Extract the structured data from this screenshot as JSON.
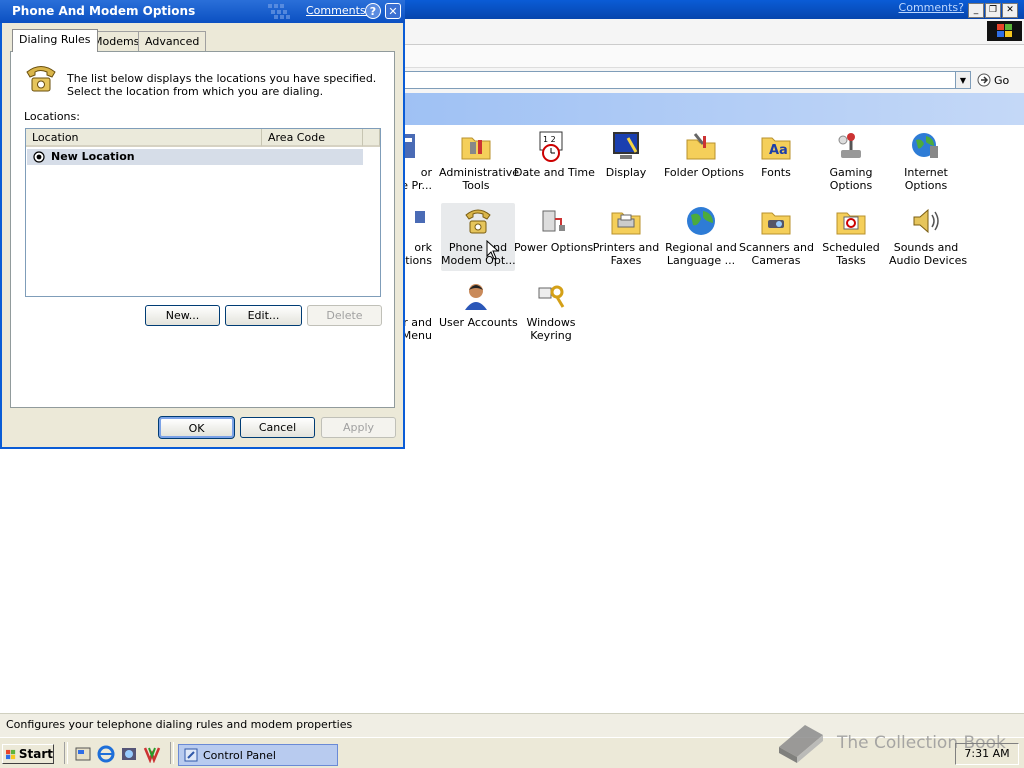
{
  "control_panel": {
    "comments_link": "Comments?",
    "go_label": "Go",
    "status_text": "Configures your telephone dialing rules and modem properties",
    "items": [
      {
        "label": "or\ne Pr...",
        "icon": "speech-icon"
      },
      {
        "label": "Administrative\nTools",
        "icon": "admin-tools-icon"
      },
      {
        "label": "Date and Time",
        "icon": "calendar-clock-icon"
      },
      {
        "label": "Display",
        "icon": "display-icon"
      },
      {
        "label": "Folder Options",
        "icon": "folder-options-icon"
      },
      {
        "label": "Fonts",
        "icon": "fonts-folder-icon"
      },
      {
        "label": "Gaming\nOptions",
        "icon": "joystick-icon"
      },
      {
        "label": "Internet\nOptions",
        "icon": "globe-icon"
      },
      {
        "label": "ork\nctions",
        "icon": "network-icon"
      },
      {
        "label": "Phone and\nModem Opt...",
        "icon": "telephone-icon"
      },
      {
        "label": "Power Options",
        "icon": "power-icon"
      },
      {
        "label": "Printers and\nFaxes",
        "icon": "printer-icon"
      },
      {
        "label": "Regional and\nLanguage ...",
        "icon": "world-icon"
      },
      {
        "label": "Scanners and\nCameras",
        "icon": "scanner-icon"
      },
      {
        "label": "Scheduled\nTasks",
        "icon": "scheduled-tasks-icon"
      },
      {
        "label": "Sounds and\nAudio Devices",
        "icon": "speaker-icon"
      },
      {
        "label": "r and\nMenu",
        "icon": "taskbar-icon"
      },
      {
        "label": "User Accounts",
        "icon": "user-icon"
      },
      {
        "label": "Windows\nKeyring",
        "icon": "keyring-icon"
      }
    ]
  },
  "taskbar": {
    "start_label": "Start",
    "task_label": "Control Panel",
    "clock": "7:31 AM",
    "watermark": "The Collection Book"
  },
  "dialog": {
    "title": "Phone And Modem Options",
    "comments_link": "Comments?",
    "help_label": "?",
    "close_label": "✕",
    "tabs": [
      "Dialing Rules",
      "Modems",
      "Advanced"
    ],
    "description": "The list below displays the locations you have specified. Select the location from which you are dialing.",
    "locations_label": "Locations:",
    "columns": [
      "Location",
      "Area Code"
    ],
    "rows": [
      {
        "location": "New Location",
        "area_code": ""
      }
    ],
    "buttons": {
      "new": "New...",
      "edit": "Edit...",
      "delete": "Delete",
      "ok": "OK",
      "cancel": "Cancel",
      "apply": "Apply"
    }
  }
}
